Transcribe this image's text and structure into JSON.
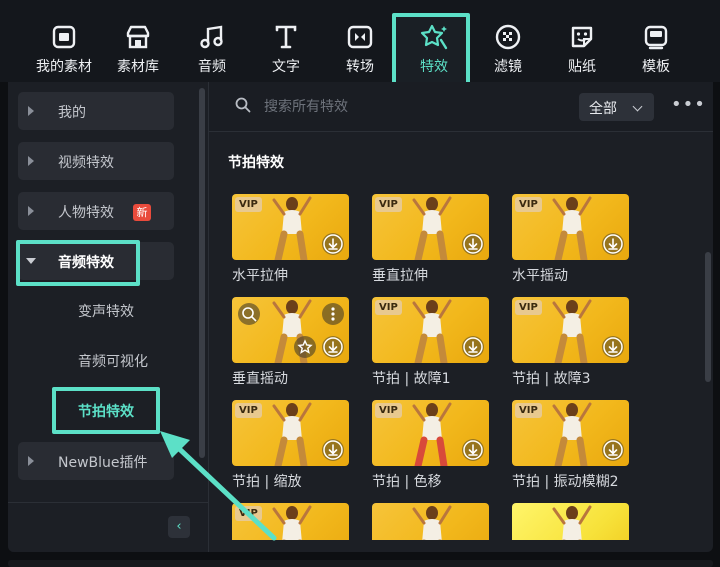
{
  "toolbar": {
    "items": [
      {
        "label": "我的素材",
        "icon": "my-assets-icon"
      },
      {
        "label": "素材库",
        "icon": "store-icon"
      },
      {
        "label": "音频",
        "icon": "music-note-icon"
      },
      {
        "label": "文字",
        "icon": "text-icon"
      },
      {
        "label": "转场",
        "icon": "transition-icon"
      },
      {
        "label": "特效",
        "icon": "sparkle-star-icon",
        "active": true
      },
      {
        "label": "滤镜",
        "icon": "filter-icon"
      },
      {
        "label": "贴纸",
        "icon": "sticker-icon"
      },
      {
        "label": "模板",
        "icon": "template-icon"
      }
    ]
  },
  "sidebar": {
    "categories": [
      {
        "label": "我的"
      },
      {
        "label": "视频特效"
      },
      {
        "label": "人物特效",
        "badge": "新"
      },
      {
        "label": "音频特效",
        "expanded": true
      },
      {
        "label": "NewBlue插件"
      }
    ],
    "subcategories": [
      {
        "label": "变声特效"
      },
      {
        "label": "音频可视化"
      },
      {
        "label": "节拍特效",
        "active": true
      }
    ],
    "collapse_icon": "‹"
  },
  "search": {
    "placeholder": "搜索所有特效",
    "filter_value": "全部",
    "more": "•••"
  },
  "content": {
    "section_title": "节拍特效",
    "vip_label": "VIP",
    "cards": [
      {
        "title": "水平拉伸"
      },
      {
        "title": "垂直拉伸"
      },
      {
        "title": "水平摇动"
      },
      {
        "title": "垂直摇动"
      },
      {
        "title": "节拍 | 故障1"
      },
      {
        "title": "节拍 | 故障3"
      },
      {
        "title": "节拍 | 缩放"
      },
      {
        "title": "节拍 | 色移"
      },
      {
        "title": "节拍 | 振动模糊2"
      }
    ]
  },
  "colors": {
    "accent": "#5ce0c7",
    "badge": "#e94b3c",
    "vip": "#e8c98f",
    "thumb": "#f2b81c"
  }
}
